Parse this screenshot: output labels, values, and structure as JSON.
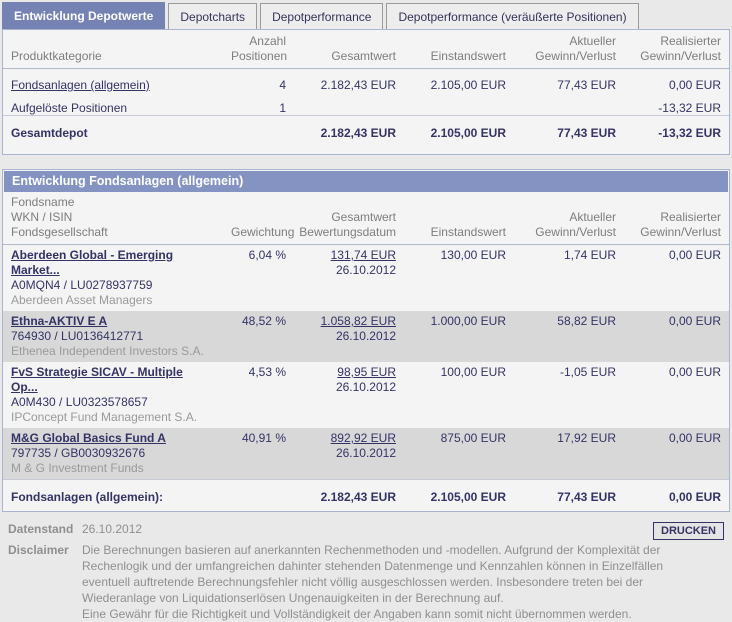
{
  "tabs": [
    {
      "label": "Entwicklung Depotwerte",
      "active": true
    },
    {
      "label": "Depotcharts",
      "active": false
    },
    {
      "label": "Depotperformance",
      "active": false
    },
    {
      "label": "Depotperformance (veräußerte Positionen)",
      "active": false
    }
  ],
  "depot_table": {
    "headers": [
      {
        "l1": "",
        "l2": "Produktkategorie"
      },
      {
        "l1": "Anzahl",
        "l2": "Positionen"
      },
      {
        "l1": "",
        "l2": "Gesamtwert"
      },
      {
        "l1": "",
        "l2": "Einstandswert"
      },
      {
        "l1": "Aktueller",
        "l2": "Gewinn/Verlust"
      },
      {
        "l1": "Realisierter",
        "l2": "Gewinn/Verlust"
      }
    ],
    "rows": [
      {
        "category": "Fondsanlagen (allgemein)",
        "anzahl": "4",
        "gesamtwert": "2.182,43 EUR",
        "einstandswert": "2.105,00 EUR",
        "aktueller": "77,43 EUR",
        "realisierter": "0,00 EUR"
      },
      {
        "category": "Aufgelöste Positionen",
        "anzahl": "1",
        "gesamtwert": "",
        "einstandswert": "",
        "aktueller": "",
        "realisierter": "-13,32 EUR"
      }
    ],
    "total": {
      "label": "Gesamtdepot",
      "anzahl": "",
      "gesamtwert": "2.182,43 EUR",
      "einstandswert": "2.105,00 EUR",
      "aktueller": "77,43 EUR",
      "realisierter": "-13,32 EUR"
    }
  },
  "funds": {
    "section_title": "Entwicklung Fondsanlagen (allgemein)",
    "headers": [
      {
        "l1": "Fondsname",
        "l2": "WKN / ISIN",
        "l3": "Fondsgesellschaft"
      },
      {
        "l1": "",
        "l2": "",
        "l3": "Gewichtung"
      },
      {
        "l1": "",
        "l2": "Gesamtwert",
        "l3": "Bewertungsdatum"
      },
      {
        "l1": "",
        "l2": "",
        "l3": "Einstandswert"
      },
      {
        "l1": "",
        "l2": "Aktueller",
        "l3": "Gewinn/Verlust"
      },
      {
        "l1": "",
        "l2": "Realisierter",
        "l3": "Gewinn/Verlust"
      }
    ],
    "rows": [
      {
        "name": "Aberdeen Global - Emerging Market...",
        "wkn_isin": "A0MQN4 /  LU0278937759",
        "company": "Aberdeen Asset Managers",
        "gewichtung": "6,04 %",
        "gesamtwert": "131,74 EUR",
        "datum": "26.10.2012",
        "einstandswert": "130,00 EUR",
        "aktueller": "1,74 EUR",
        "realisierter": "0,00 EUR"
      },
      {
        "name": "Ethna-AKTIV E A",
        "wkn_isin": "764930 /  LU0136412771",
        "company": "Ethenea Independent Investors S.A.",
        "gewichtung": "48,52 %",
        "gesamtwert": "1.058,82 EUR",
        "datum": "26.10.2012",
        "einstandswert": "1.000,00 EUR",
        "aktueller": "58,82 EUR",
        "realisierter": "0,00 EUR"
      },
      {
        "name": "FvS Strategie SICAV - Multiple Op...",
        "wkn_isin": "A0M430 /  LU0323578657",
        "company": "IPConcept Fund Management S.A.",
        "gewichtung": "4,53 %",
        "gesamtwert": "98,95 EUR",
        "datum": "26.10.2012",
        "einstandswert": "100,00 EUR",
        "aktueller": "-1,05 EUR",
        "realisierter": "0,00 EUR"
      },
      {
        "name": "M&G Global Basics Fund A",
        "wkn_isin": "797735 /  GB0030932676",
        "company": "M & G Investment Funds",
        "gewichtung": "40,91 %",
        "gesamtwert": "892,92 EUR",
        "datum": "26.10.2012",
        "einstandswert": "875,00 EUR",
        "aktueller": "17,92 EUR",
        "realisierter": "0,00 EUR"
      }
    ],
    "total": {
      "label": "Fondsanlagen (allgemein):",
      "gesamtwert": "2.182,43 EUR",
      "einstandswert": "2.105,00 EUR",
      "aktueller": "77,43 EUR",
      "realisierter": "0,00 EUR"
    }
  },
  "footer": {
    "datenstand_label": "Datenstand",
    "datenstand_value": "26.10.2012",
    "disclaimer_label": "Disclaimer",
    "disclaimer_p1": "Die Berechnungen basieren auf anerkannten Rechenmethoden und -modellen. Aufgrund der Komplexität der Rechenlogik und der umfangreichen dahinter stehenden Datenmenge und Kennzahlen können in Einzelfällen eventuell auftretende Berechnungsfehler nicht völlig ausgeschlossen werden. Insbesondere treten bei der Wiederanlage von Liquidationserlösen Ungenauigkeiten in der Berechnung auf.",
    "disclaimer_p2": "Eine Gewähr für die Richtigkeit und Vollständigkeit der Angaben kann somit nicht übernommen werden.",
    "print_label": "DRUCKEN"
  },
  "colors": {
    "active_tab_bg": "#7583b4",
    "section_bar_bg": "#8593c3",
    "panel_border": "#a9b4d0",
    "text_navy": "#333366",
    "header_gray": "#7d7d7d",
    "stripe_gray": "#d8d8d8",
    "page_bg": "#e9e9e9"
  }
}
